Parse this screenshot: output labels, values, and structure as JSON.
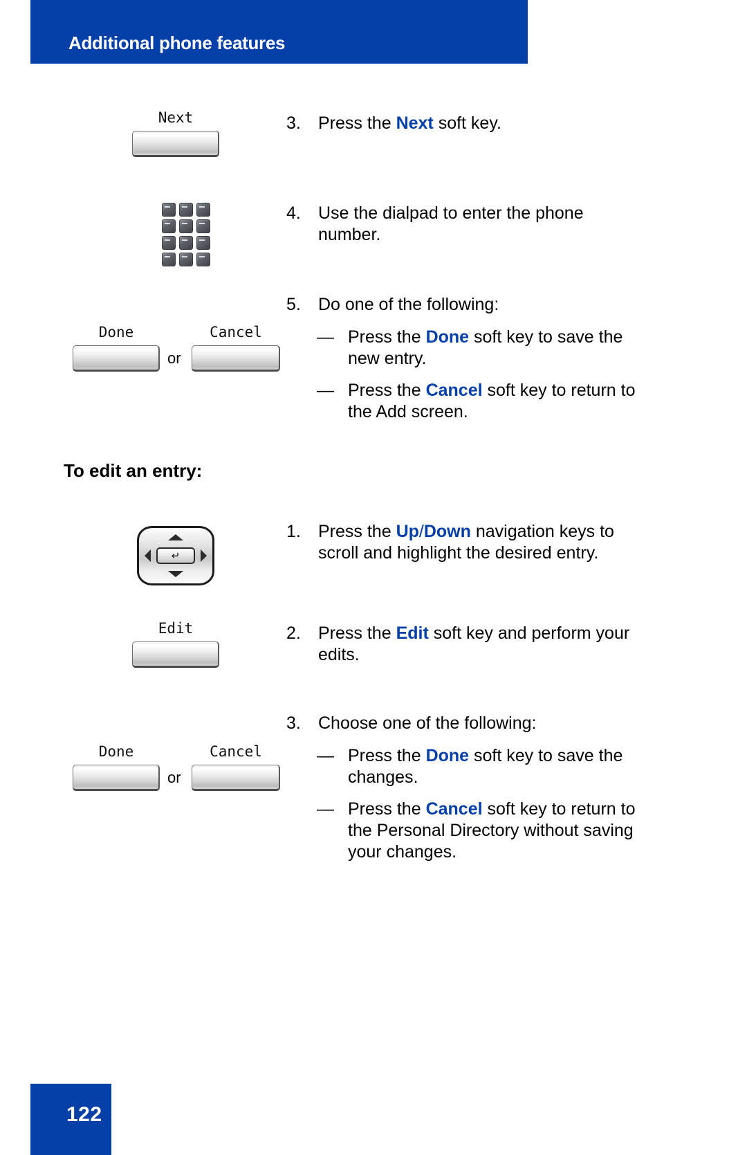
{
  "header": {
    "title": "Additional phone features",
    "bar_color": "#0440A8"
  },
  "footer": {
    "page_number": "122",
    "bar_color": "#0440A8"
  },
  "accent_color": "#0440A8",
  "graphics": {
    "next_softkey_label": "Next",
    "done_softkey_label": "Done",
    "cancel_softkey_label": "Cancel",
    "edit_softkey_label": "Edit",
    "or_label": "or",
    "nav_enter_glyph": "↵"
  },
  "section_heading": "To edit an entry:",
  "steps_add": [
    {
      "number": "3.",
      "prefix": "Press the ",
      "keyword": "Next",
      "suffix": " soft key."
    },
    {
      "number": "4.",
      "prefix": "Use the dialpad to enter the phone number.",
      "keyword": "",
      "suffix": ""
    },
    {
      "number": "5.",
      "prefix": "Do one of the following:",
      "keyword": "",
      "suffix": ""
    }
  ],
  "substeps_add": [
    {
      "dash": "—",
      "prefix": "Press the ",
      "keyword": "Done",
      "suffix": " soft key to save the new entry."
    },
    {
      "dash": "—",
      "prefix": "Press the ",
      "keyword": "Cancel",
      "suffix": " soft key to return to the Add screen."
    }
  ],
  "steps_edit": [
    {
      "number": "1.",
      "prefix": "Press the ",
      "keyword": "Up",
      "keyword_sep": "/",
      "keyword2": "Down",
      "suffix": " navigation keys to scroll and highlight the desired entry."
    },
    {
      "number": "2.",
      "prefix": "Press the ",
      "keyword": "Edit",
      "suffix": " soft key and perform your edits."
    },
    {
      "number": "3.",
      "prefix": "Choose one of the following:",
      "keyword": "",
      "suffix": ""
    }
  ],
  "substeps_edit": [
    {
      "dash": "—",
      "prefix": "Press the ",
      "keyword": "Done",
      "suffix": " soft key to save the changes."
    },
    {
      "dash": "—",
      "prefix": "Press the ",
      "keyword": "Cancel",
      "suffix": " soft key to return to the Personal Directory without saving your changes."
    }
  ]
}
